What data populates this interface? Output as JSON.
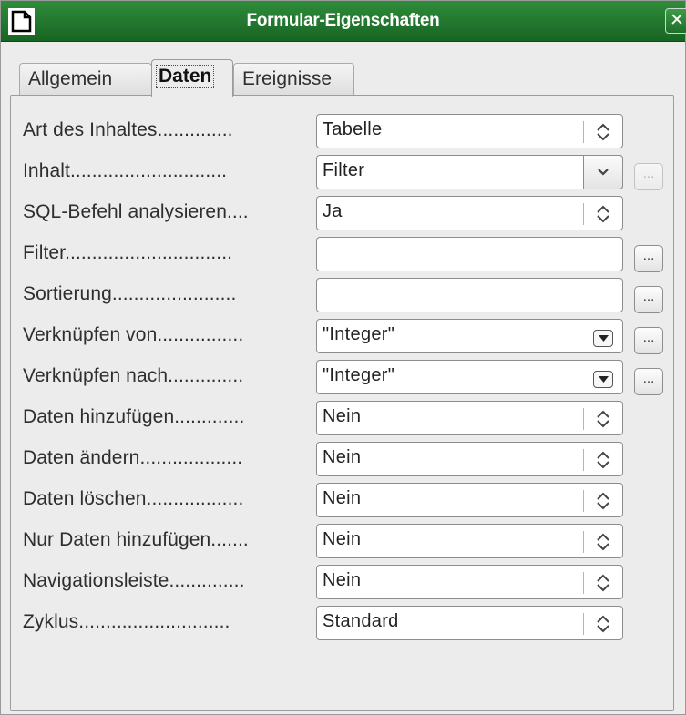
{
  "window": {
    "title": "Formular-Eigenschaften",
    "close_glyph": "✕"
  },
  "tabs": [
    {
      "label": "Allgemein",
      "active": false
    },
    {
      "label": "Daten",
      "active": true
    },
    {
      "label": "Ereignisse",
      "active": false
    }
  ],
  "rows": [
    {
      "label": "Art des Inhaltes..............",
      "value": "Tabelle",
      "control": "spin",
      "more": "none"
    },
    {
      "label": "Inhalt.............................",
      "value": "Filter",
      "control": "dropdown",
      "more": "disabled"
    },
    {
      "label": "SQL-Befehl analysieren....",
      "value": "Ja",
      "control": "spin",
      "more": "none"
    },
    {
      "label": "Filter...............................",
      "value": "",
      "control": "text",
      "more": "enabled"
    },
    {
      "label": "Sortierung.......................",
      "value": "",
      "control": "text",
      "more": "enabled"
    },
    {
      "label": "Verknüpfen von................",
      "value": "\"Integer\"",
      "control": "listbox",
      "more": "enabled"
    },
    {
      "label": "Verknüpfen nach..............",
      "value": "\"Integer\"",
      "control": "listbox",
      "more": "enabled"
    },
    {
      "label": "Daten hinzufügen.............",
      "value": "Nein",
      "control": "spin",
      "more": "none"
    },
    {
      "label": "Daten ändern...................",
      "value": "Nein",
      "control": "spin",
      "more": "none"
    },
    {
      "label": "Daten löschen..................",
      "value": "Nein",
      "control": "spin",
      "more": "none"
    },
    {
      "label": "Nur Daten hinzufügen.......",
      "value": "Nein",
      "control": "spin",
      "more": "none"
    },
    {
      "label": "Navigationsleiste..............",
      "value": "Nein",
      "control": "spin",
      "more": "none"
    },
    {
      "label": "Zyklus............................",
      "value": "Standard",
      "control": "spin",
      "more": "none"
    }
  ],
  "more_button_text": "...",
  "colors": {
    "titlebar": "#1f7a2c",
    "window_bg": "#ececec",
    "field_border": "#8d8d8d"
  }
}
